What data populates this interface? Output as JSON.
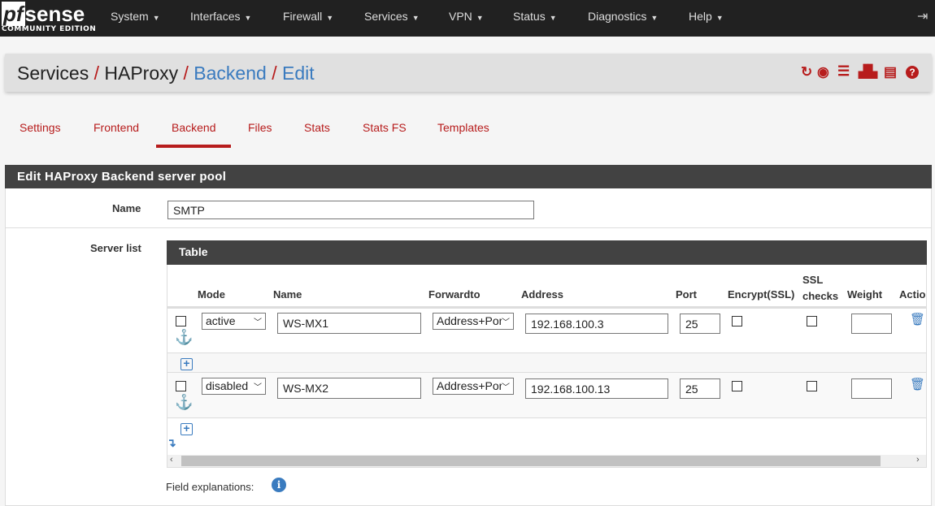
{
  "nav": {
    "logo": {
      "pf": "pf",
      "sense": "sense",
      "edition": "COMMUNITY EDITION"
    },
    "menu": [
      "System",
      "Interfaces",
      "Firewall",
      "Services",
      "VPN",
      "Status",
      "Diagnostics",
      "Help"
    ],
    "logout_icon": "sign-out-icon"
  },
  "breadcrumb": {
    "items": [
      "Services",
      "HAProxy",
      "Backend",
      "Edit"
    ],
    "icons": [
      "refresh-icon",
      "stop-icon",
      "sliders-icon",
      "bar-chart-icon",
      "list-alt-icon",
      "question-circle-icon"
    ]
  },
  "tabs": [
    "Settings",
    "Frontend",
    "Backend",
    "Files",
    "Stats",
    "Stats FS",
    "Templates"
  ],
  "active_tab": "Backend",
  "panel": {
    "title": "Edit HAProxy Backend server pool",
    "name_label": "Name",
    "name_value": "SMTP",
    "server_list_label": "Server list",
    "table": {
      "title": "Table",
      "columns": [
        "Mode",
        "Name",
        "Forwardto",
        "Address",
        "Port",
        "Encrypt(SSL)",
        "SSL checks",
        "Weight",
        "Actio"
      ],
      "rows": [
        {
          "mode": "active",
          "name": "WS-MX1",
          "forwardto": "Address+Por",
          "address": "192.168.100.3",
          "port": "25",
          "encrypt": false,
          "ssl_checks": false,
          "weight": ""
        },
        {
          "mode": "disabled",
          "name": "WS-MX2",
          "forwardto": "Address+Por",
          "address": "192.168.100.13",
          "port": "25",
          "encrypt": false,
          "ssl_checks": false,
          "weight": ""
        }
      ]
    },
    "field_explanations": "Field explanations:"
  },
  "colors": {
    "accent": "#b71c1c",
    "link": "#3a7bbf",
    "navbar": "#212121",
    "panel_header": "#424242"
  }
}
